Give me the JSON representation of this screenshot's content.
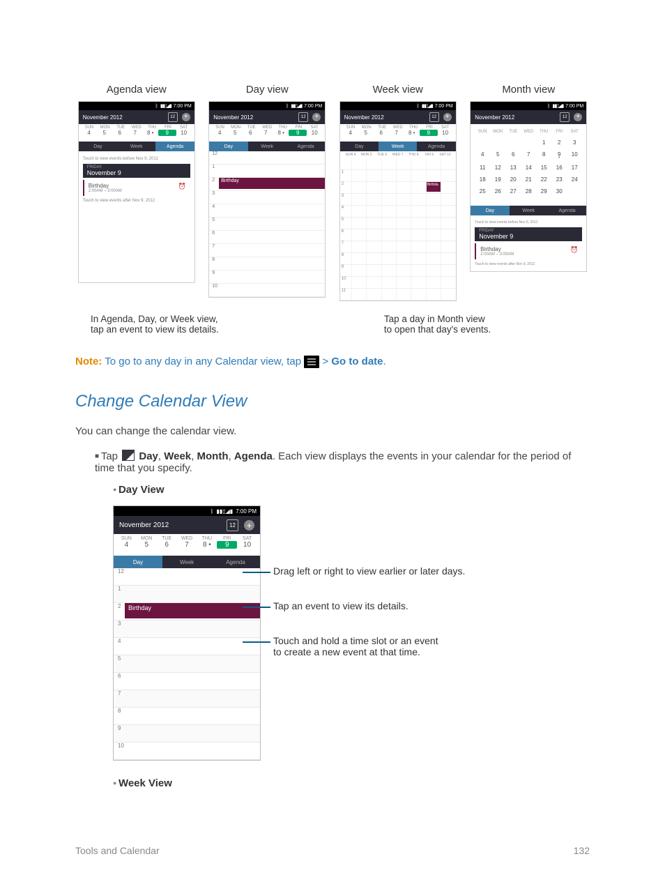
{
  "views": {
    "agenda": {
      "title": "Agenda view"
    },
    "day": {
      "title": "Day view"
    },
    "week": {
      "title": "Week view"
    },
    "month": {
      "title": "Month view"
    }
  },
  "phone_common": {
    "status_time": "7:00 PM",
    "appbar_title": "November 2012",
    "cal_icon_num": "12",
    "days_short": [
      "SUN",
      "MON",
      "TUE",
      "WED",
      "THU",
      "FRI",
      "SAT"
    ],
    "dates_week": [
      "4",
      "5",
      "6",
      "7",
      "8",
      "9",
      "10"
    ],
    "highlight_index": 5,
    "tabs": {
      "day": "Day",
      "week": "Week",
      "agenda": "Agenda"
    }
  },
  "agenda_body": {
    "touch_before": "Touch to view events before Nov 9, 2012",
    "date_small": "FRIDAY",
    "date_big": "November 9",
    "event_name": "Birthday",
    "event_time": "2:00AM – 3:00AM",
    "touch_after": "Touch to view events after Nov 9, 2012"
  },
  "day_body": {
    "hours": [
      "12",
      "1",
      "2",
      "3",
      "4",
      "5",
      "6",
      "7",
      "8",
      "9",
      "10"
    ],
    "event_at": 2,
    "event_label": "Birthday"
  },
  "week_body": {
    "small_days": [
      "SUN 4",
      "MON 5",
      "TUE 6",
      "WED 7",
      "THU 8",
      "FRI 9",
      "SAT 10"
    ],
    "hours_side": [
      "",
      "1",
      "2",
      "3",
      "4",
      "5",
      "6",
      "7",
      "8",
      "9",
      "10",
      "11"
    ],
    "event_hour": 2,
    "event_col": 5,
    "event_label": "Birthda"
  },
  "month_body": {
    "days": [
      "SUN",
      "MON",
      "TUE",
      "WED",
      "THU",
      "FRI",
      "SAT"
    ],
    "rows": [
      [
        "",
        "",
        "",
        "",
        "1",
        "2",
        "3"
      ],
      [
        "4",
        "5",
        "6",
        "7",
        "8",
        "9",
        "10"
      ],
      [
        "11",
        "12",
        "13",
        "14",
        "15",
        "16",
        "17"
      ],
      [
        "18",
        "19",
        "20",
        "21",
        "22",
        "23",
        "24"
      ],
      [
        "25",
        "26",
        "27",
        "28",
        "29",
        "30",
        ""
      ],
      [
        "",
        "",
        "",
        "",
        "",
        "",
        ""
      ]
    ],
    "dot_cells": [
      "9"
    ],
    "cur_cell": "9",
    "tabs": {
      "day": "Day",
      "week": "Week",
      "agenda": "Agenda"
    },
    "agenda_touch_before": "Touch to view events before Nov 9, 2012",
    "agenda_date_small": "FRIDAY",
    "agenda_date_big": "November 9",
    "agenda_event": "Birthday",
    "agenda_event_time": "2:00AM – 3:00AM",
    "agenda_touch_after": "Touch to view events after Nov 9, 2012"
  },
  "captions": {
    "left_l1": "In Agenda, Day, or Week view,",
    "left_l2": "tap an event to view its details.",
    "right_l1": "Tap a day in Month view",
    "right_l2": "to open that day's events."
  },
  "note": {
    "label": "Note:",
    "text_a": "To go to any day in any Calendar view, tap",
    "text_b": ">",
    "text_c": "Go to date",
    "text_d": "."
  },
  "section_title": "Change Calendar View",
  "intro_para": "You can change the calendar view.",
  "bullet1_a": "Tap",
  "bullet1_b": "Day",
  "bullet1_c": "Week",
  "bullet1_d": "Month",
  "bullet1_e": "Agenda",
  "bullet1_f": ". Each view displays the events in your calendar for the period of time that you specify.",
  "sub_day": "Day View",
  "sub_week": "Week View",
  "callouts": {
    "c1": "Drag left or right to view earlier or later days.",
    "c2": "Tap an event to view its details.",
    "c3a": "Touch and hold a time slot or an event",
    "c3b": "to create a new event at that time."
  },
  "footer": {
    "left": "Tools and Calendar",
    "right": "132"
  }
}
